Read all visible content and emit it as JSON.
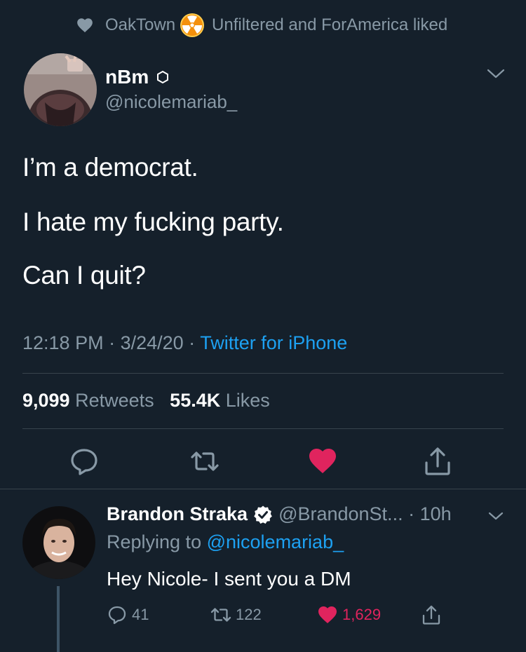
{
  "context": {
    "icon_left": "heart-icon",
    "user1": "OakTown",
    "icon_mid": "radiation-hazard-icon",
    "rest": "Unfiltered and ForAmerica liked"
  },
  "tweet": {
    "display_name": "nBm",
    "handle": "@nicolemariab_",
    "lines": [
      "I’m a democrat.",
      "I hate my fucking party.",
      "Can I quit?"
    ],
    "time": "12:18 PM",
    "date": "3/24/20",
    "source": "Twitter for iPhone",
    "retweets_count": "9,099",
    "retweets_label": "Retweets",
    "likes_count": "55.4K",
    "likes_label": "Likes"
  },
  "reply": {
    "display_name": "Brandon Straka",
    "handle": "@BrandonSt...",
    "time": "10h",
    "replying_prefix": "Replying to",
    "replying_to": "@nicolemariab_",
    "text": "Hey Nicole- I sent you a DM",
    "reply_count": "41",
    "retweet_count": "122",
    "like_count": "1,629"
  },
  "colors": {
    "background": "#15202b",
    "muted": "#8899a6",
    "link": "#1da1f2",
    "like": "#e0245e",
    "divider": "#38444d"
  }
}
